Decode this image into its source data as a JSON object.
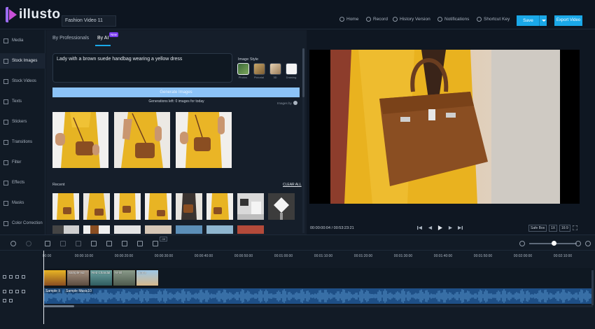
{
  "app": {
    "logo_text": "illusto",
    "project_name": "Fashion Video 11"
  },
  "topnav": [
    {
      "label": "Home",
      "icon": "home-icon"
    },
    {
      "label": "Record",
      "icon": "record-icon"
    },
    {
      "label": "History Version",
      "icon": "history-icon"
    },
    {
      "label": "Notifications",
      "icon": "bell-icon"
    },
    {
      "label": "Shortcut Key",
      "icon": "keyboard-icon"
    }
  ],
  "save_label": "Save",
  "export_label": "Export Video",
  "sidebar": {
    "items": [
      {
        "label": "Media",
        "icon": "layers-icon"
      },
      {
        "label": "Stock Images",
        "icon": "stack-icon"
      },
      {
        "label": "Stock Videos",
        "icon": "film-stack-icon"
      },
      {
        "label": "Texts",
        "icon": "text-icon"
      },
      {
        "label": "Stickers",
        "icon": "sticker-icon"
      },
      {
        "label": "Transitions",
        "icon": "transition-icon"
      },
      {
        "label": "Filter",
        "icon": "filter-icon"
      },
      {
        "label": "Effects",
        "icon": "effects-icon"
      },
      {
        "label": "Masks",
        "icon": "mask-icon"
      },
      {
        "label": "Color Correction",
        "icon": "color-icon"
      }
    ]
  },
  "panel": {
    "tabs": [
      {
        "label": "By Professionals"
      },
      {
        "label": "By AI"
      }
    ],
    "new_badge": "New",
    "prompt_value": "Lady with a brown suede handbag wearing a yellow dress",
    "image_style_label": "Image Style",
    "styles": [
      {
        "label": "Photos"
      },
      {
        "label": "Pictorial"
      },
      {
        "label": "3D"
      },
      {
        "label": "Drawing"
      }
    ],
    "generate_label": "Generate Images",
    "generations_left": "Generations left: 0 images for today",
    "images_by": "Images by",
    "recent_label": "Recent",
    "clear_all": "CLEAR ALL"
  },
  "preview": {
    "timecode": "00:00:00:04 / 00:53:23:21",
    "safe_box": "Safe Box",
    "zoom": "1X",
    "ratio": "16:9"
  },
  "timeline": {
    "ticks": [
      "00:00",
      "00:00:10:00",
      "00:00:20:00",
      "00:00:30:00",
      "00:00:40:00",
      "00:00:50:00",
      "00:01:00:00",
      "00:01:10:00",
      "00:01:20:00",
      "00:01:30:00",
      "00:01:40:00",
      "00:01:50:00",
      "00:02:00:00",
      "00:02:10:00"
    ],
    "clips": [
      "",
      "Sample-vid",
      "Red Chandal",
      "AI-Ol",
      "Home"
    ],
    "audio_clips": [
      "Sample Ii",
      "Sample Music10"
    ],
    "snap_label": "Off"
  },
  "colors": {
    "accent": "#1aa8e8",
    "dress": "#e8b624",
    "bag": "#8a4e22",
    "audio": "#1e4f86"
  }
}
